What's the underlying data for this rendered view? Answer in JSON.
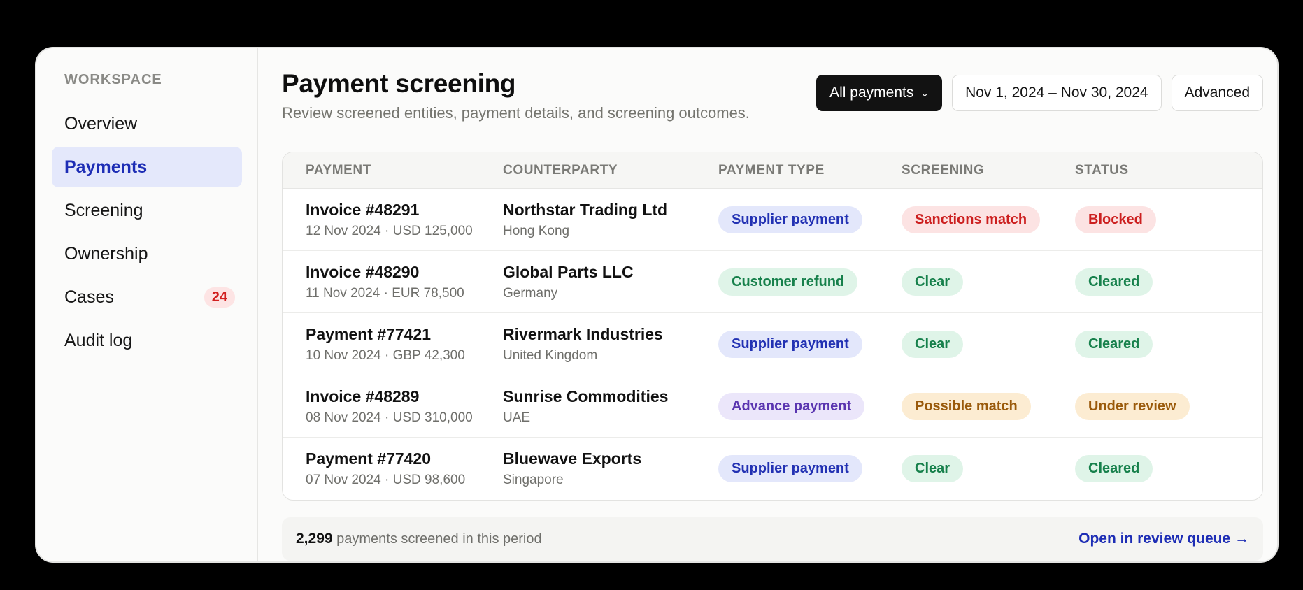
{
  "sidebar": {
    "section_label": "WORKSPACE",
    "items": [
      {
        "label": "Overview"
      },
      {
        "label": "Payments",
        "active": true
      },
      {
        "label": "Screening"
      },
      {
        "label": "Ownership"
      },
      {
        "label": "Cases",
        "badge": "24"
      },
      {
        "label": "Audit log"
      }
    ]
  },
  "header": {
    "title": "Payment screening",
    "subtitle": "Review screened entities, payment details, and screening outcomes.",
    "filter_label": "All payments",
    "filter_icon": "chevron-down-icon",
    "date_range": "Nov 1, 2024 – Nov 30, 2024",
    "advanced_label": "Advanced"
  },
  "table": {
    "columns": [
      "PAYMENT",
      "COUNTERPARTY",
      "PAYMENT TYPE",
      "SCREENING",
      "STATUS"
    ],
    "rows": [
      {
        "payment": "Invoice #48291",
        "details": "12 Nov 2024 · USD 125,000",
        "counterparty": "Northstar Trading Ltd",
        "country": "Hong Kong",
        "type": "Supplier payment",
        "screening": "Sanctions match",
        "status": "Blocked"
      },
      {
        "payment": "Invoice #48290",
        "details": "11 Nov 2024 · EUR 78,500",
        "counterparty": "Global Parts LLC",
        "country": "Germany",
        "type": "Customer refund",
        "screening": "Clear",
        "status": "Cleared"
      },
      {
        "payment": "Payment #77421",
        "details": "10 Nov 2024 · GBP 42,300",
        "counterparty": "Rivermark Industries",
        "country": "United Kingdom",
        "type": "Supplier payment",
        "screening": "Clear",
        "status": "Cleared"
      },
      {
        "payment": "Invoice #48289",
        "details": "08 Nov 2024 · USD 310,000",
        "counterparty": "Sunrise Commodities",
        "country": "UAE",
        "type": "Advance payment",
        "screening": "Possible match",
        "status": "Under review"
      },
      {
        "payment": "Payment #77420",
        "details": "07 Nov 2024 · USD 98,600",
        "counterparty": "Bluewave Exports",
        "country": "Singapore",
        "type": "Supplier payment",
        "screening": "Clear",
        "status": "Cleared"
      }
    ]
  },
  "footer": {
    "count": "2,299",
    "count_text": "payments screened in this period",
    "link_label": "Open in review queue →"
  },
  "colors": {
    "accent": "#1d2db5",
    "active_nav_bg": "#e4e8fb",
    "blocked": "#cc1f1f",
    "cleared": "#16804b",
    "review": "#9a5a0b"
  }
}
